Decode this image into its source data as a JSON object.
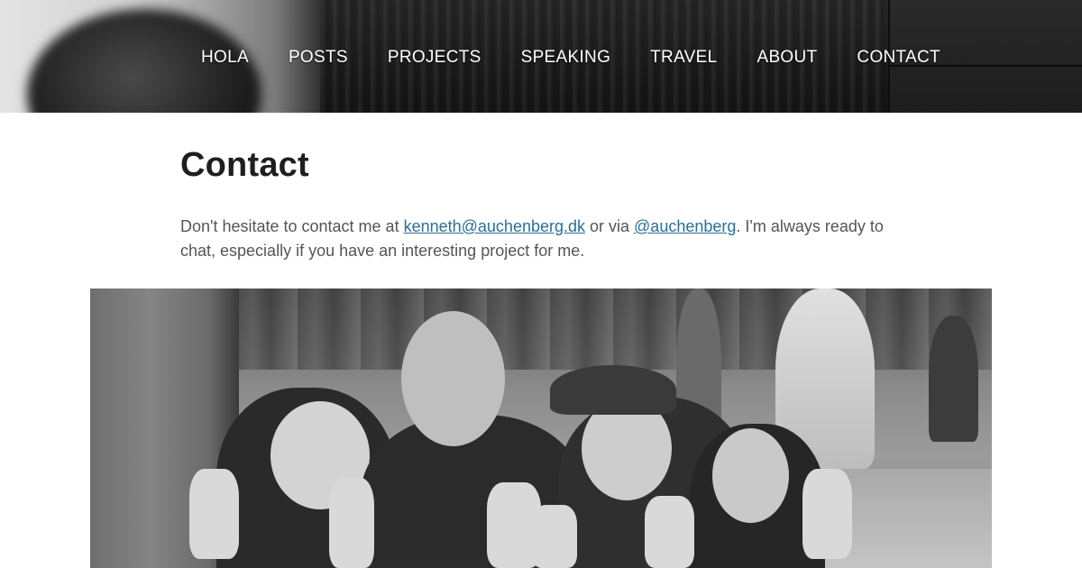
{
  "nav": {
    "items": [
      "HOLA",
      "POSTS",
      "PROJECTS",
      "SPEAKING",
      "TRAVEL",
      "ABOUT",
      "CONTACT"
    ]
  },
  "page": {
    "title": "Contact",
    "intro_before_email": "Don't hesitate to contact me at ",
    "email": "kenneth@auchenberg.dk",
    "intro_between": " or via ",
    "twitter": "@auchenberg",
    "intro_after": ". I'm always ready to chat, especially if you have an interesting project for me."
  },
  "colors": {
    "link": "#2a6f97",
    "heading": "#1e1e1e",
    "body_text": "#555555",
    "nav_text": "#ffffff"
  }
}
